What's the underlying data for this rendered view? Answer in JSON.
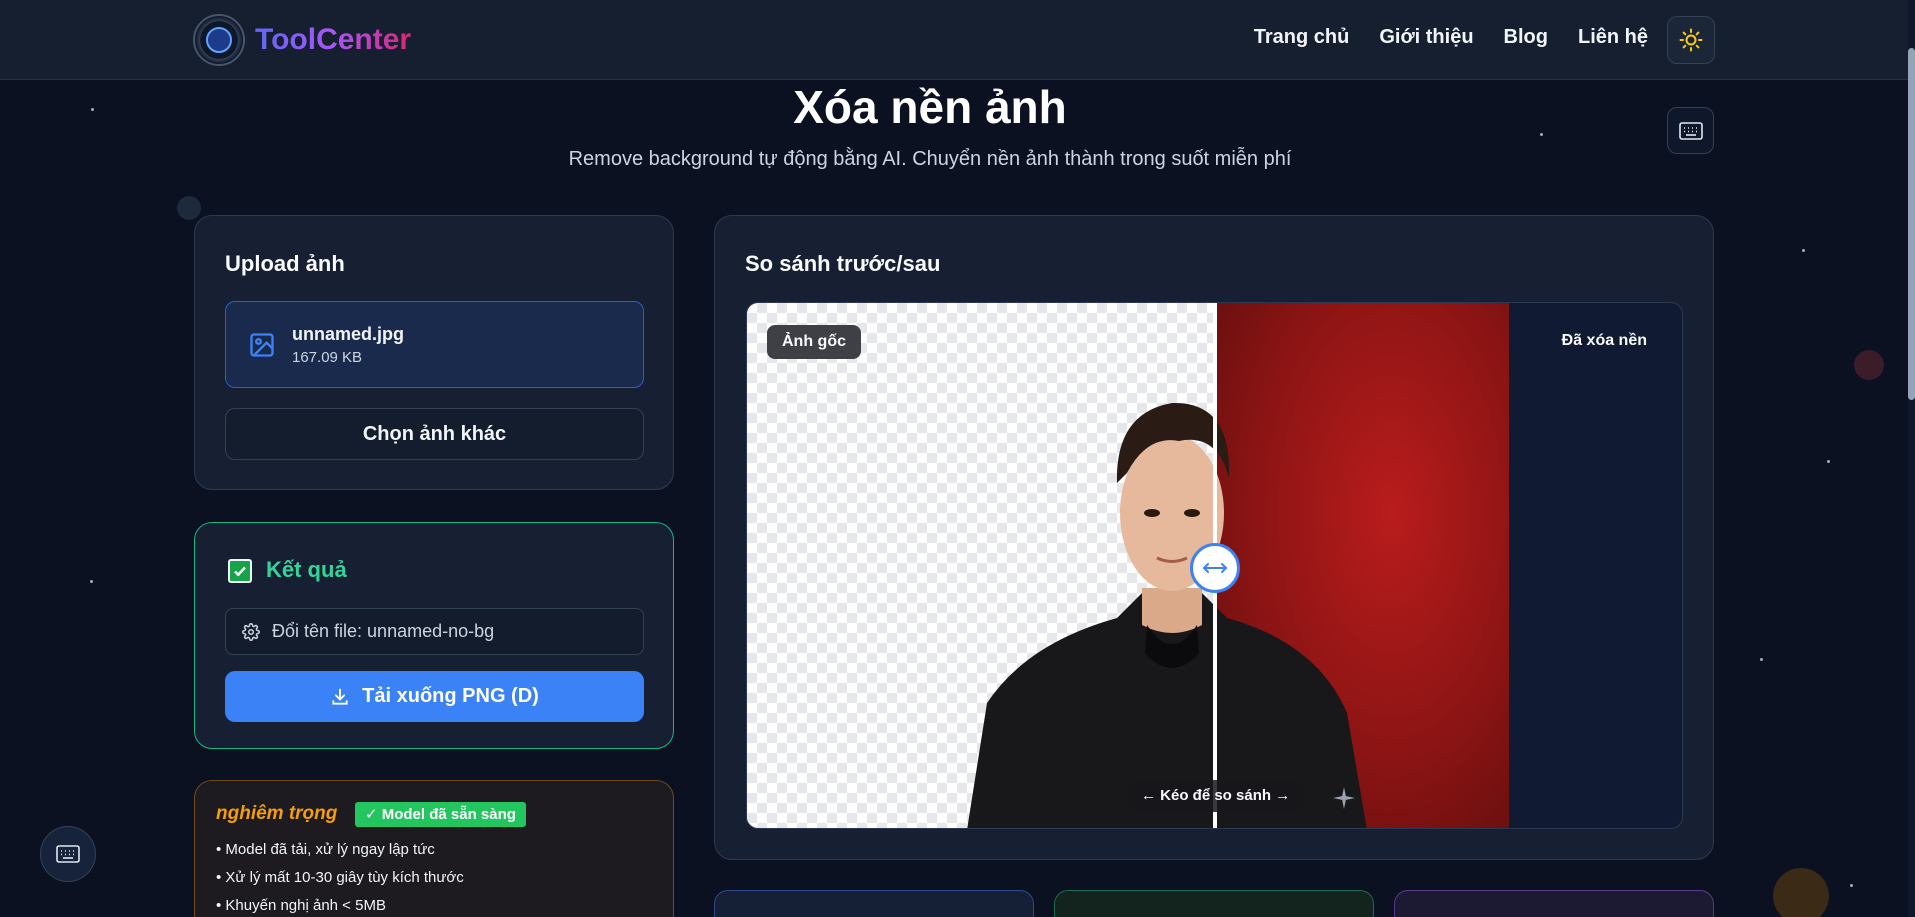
{
  "header": {
    "logo_text": "ToolCenter",
    "nav": [
      "Trang chủ",
      "Giới thiệu",
      "Blog",
      "Liên hệ"
    ]
  },
  "page": {
    "title": "Xóa nền ảnh",
    "subtitle": "Remove background tự động bằng AI. Chuyển nền ảnh thành trong suốt miễn phí"
  },
  "upload": {
    "title": "Upload ảnh",
    "file_name": "unnamed.jpg",
    "file_size": "167.09 KB",
    "choose_label": "Chọn ảnh khác"
  },
  "result": {
    "title": "Kết quả",
    "rename_text": "Đổi tên file: unnamed-no-bg",
    "download_label": "Tải xuống PNG (D)"
  },
  "warning": {
    "title": "nghiêm trọng",
    "badge": "✓ Model đã sẵn sàng",
    "items": [
      "• Model đã tải, xử lý ngay lập tức",
      "• Xử lý mất 10-30 giây tùy kích thước",
      "• Khuyến nghị ảnh < 5MB"
    ]
  },
  "compare": {
    "title": "So sánh trước/sau",
    "label_original": "Ảnh gốc",
    "label_removed": "Đã xóa nền",
    "drag_hint": "← Kéo để so sánh →"
  },
  "colors": {
    "accent": "#3b82f6",
    "success": "#22c55e",
    "warning": "#f59e0b"
  }
}
